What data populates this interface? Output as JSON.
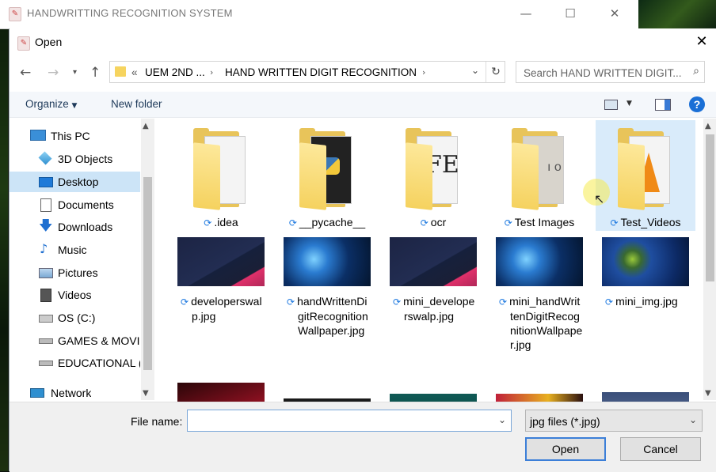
{
  "parent_window": {
    "title": "HANDWRITTING RECOGNITION SYSTEM"
  },
  "dialog": {
    "title": "Open",
    "address": {
      "overflow": "«",
      "segment_1": "UEM 2ND ...",
      "segment_2": "HAND WRITTEN DIGIT RECOGNITION"
    },
    "search_placeholder": "Search HAND WRITTEN DIGIT...",
    "toolbar": {
      "organize": "Organize",
      "new_folder": "New folder"
    },
    "nav": [
      {
        "label": "This PC",
        "icon": "pc-icon"
      },
      {
        "label": "3D Objects",
        "icon": "3d-objects-icon"
      },
      {
        "label": "Desktop",
        "icon": "desktop-icon",
        "selected": true
      },
      {
        "label": "Documents",
        "icon": "documents-icon"
      },
      {
        "label": "Downloads",
        "icon": "downloads-icon"
      },
      {
        "label": "Music",
        "icon": "music-icon"
      },
      {
        "label": "Pictures",
        "icon": "pictures-icon"
      },
      {
        "label": "Videos",
        "icon": "videos-icon"
      },
      {
        "label": "OS (C:)",
        "icon": "drive-icon"
      },
      {
        "label": "GAMES & MOVI",
        "icon": "drive-icon"
      },
      {
        "label": "EDUCATIONAL (",
        "icon": "drive-icon"
      },
      {
        "label": "Network",
        "icon": "network-icon"
      }
    ],
    "folders": [
      {
        "name": ".idea"
      },
      {
        "name": "__pycache__"
      },
      {
        "name": "ocr"
      },
      {
        "name": "Test Images"
      },
      {
        "name": "Test_Videos",
        "selected": true
      }
    ],
    "images": [
      {
        "name_lines": [
          "developerswal",
          "p.jpg"
        ]
      },
      {
        "name_lines": [
          "handWrittenDi",
          "gitRecognition",
          "Wallpaper.jpg"
        ]
      },
      {
        "name_lines": [
          "mini_develope",
          "rswalp.jpg"
        ]
      },
      {
        "name_lines": [
          "mini_handWrit",
          "tenDigitRecog",
          "nitionWallpape",
          "r.jpg"
        ]
      },
      {
        "name_lines": [
          "mini_img.jpg"
        ]
      }
    ],
    "file_name_label": "File name:",
    "file_name_value": "",
    "file_type": "jpg files (*.jpg)",
    "open_button": "Open",
    "cancel_button": "Cancel",
    "colors": {
      "accent": "#1f7ae0",
      "selection": "#cce4f7",
      "folder": "#f5d25f"
    }
  }
}
